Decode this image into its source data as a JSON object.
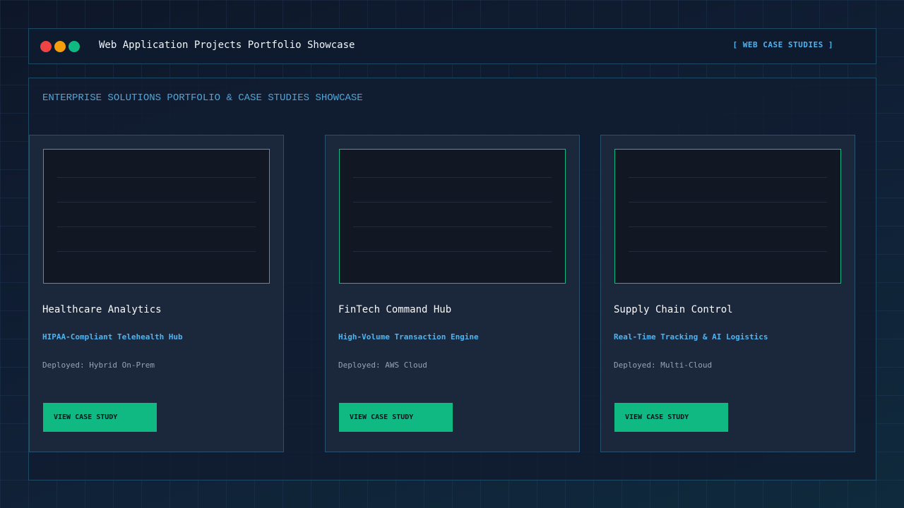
{
  "window": {
    "title": "Web Application Projects Portfolio Showcase",
    "tag": "[ WEB CASE STUDIES ]"
  },
  "panel": {
    "heading": "ENTERPRISE SOLUTIONS PORTFOLIO & CASE STUDIES SHOWCASE"
  },
  "cards": [
    {
      "title": "FinTech Command Hub",
      "subtitle": "High-Volume Transaction Engine",
      "deployment": "Deployed: AWS Cloud",
      "button_label": "VIEW CASE STUDY"
    },
    {
      "title": "Supply Chain Control",
      "subtitle": "Real-Time Tracking & AI Logistics",
      "deployment": "Deployed: Multi-Cloud",
      "button_label": "VIEW CASE STUDY"
    },
    {
      "title": "Healthcare Analytics",
      "subtitle": "HIPAA-Compliant Telehealth Hub",
      "deployment": "Deployed: Hybrid On-Prem",
      "button_label": "VIEW CASE STUDY"
    }
  ],
  "colors": {
    "accent_green": "#10b981",
    "accent_blue": "#4fb3f0",
    "close_red": "#ef4444",
    "minimize_yellow": "#f59e0b"
  }
}
